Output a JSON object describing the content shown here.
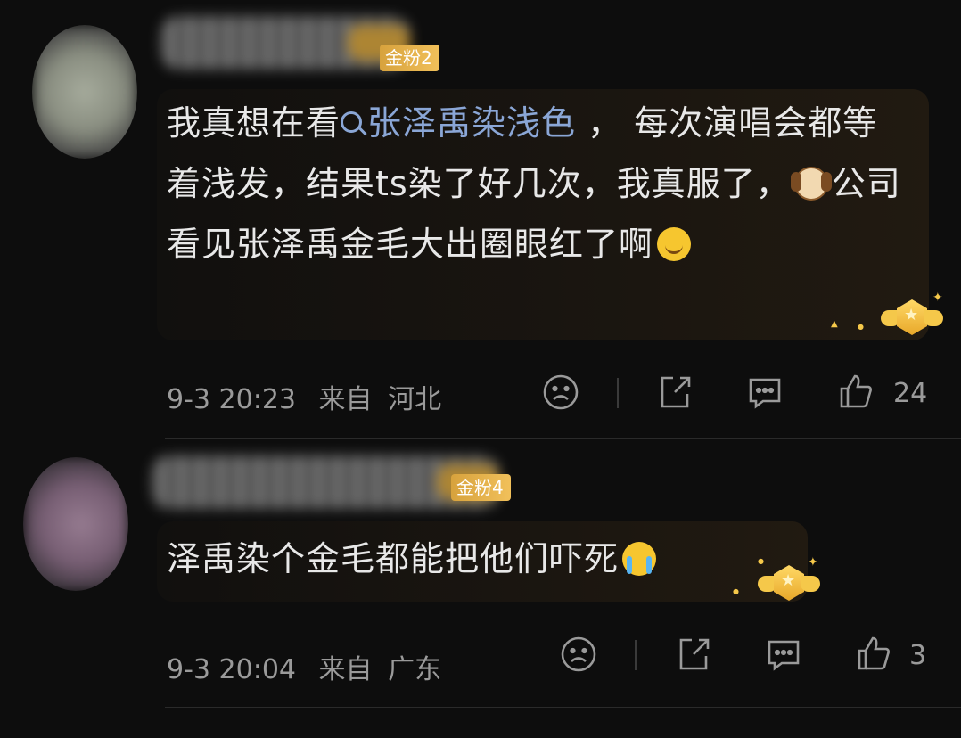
{
  "comments": [
    {
      "fan_badge": "金粉2",
      "text_before_topic": "我真想在看",
      "topic": "张泽禹染浅色",
      "text_after_topic": " ，  每次演唱会都等着浅发，结果ts染了好几次，我真服了，",
      "emoji_1": "dog-emoji",
      "text_after_emoji": "公司看见张泽禹金毛大出圈眼红了啊",
      "emoji_2": "dizzy-emoji",
      "timestamp": "9-3 20:23",
      "source_label": "来自",
      "location": "河北",
      "like_count": "24"
    },
    {
      "fan_badge": "金粉4",
      "text": "泽禹染个金毛都能把他们吓死",
      "emoji": "crying-emoji",
      "timestamp": "9-3 20:04",
      "source_label": "来自",
      "location": "广东",
      "like_count": "3"
    }
  ],
  "icons": {
    "dislike": "sad-face-icon",
    "share": "share-icon",
    "reply": "comment-icon",
    "like": "thumbs-up-icon",
    "badge": "winged-star-badge-icon"
  },
  "colors": {
    "background": "#0d0d0d",
    "topic_link": "#8aa6d6",
    "fan_badge": "#e6b04a",
    "meta_text": "#9a9a9a"
  }
}
